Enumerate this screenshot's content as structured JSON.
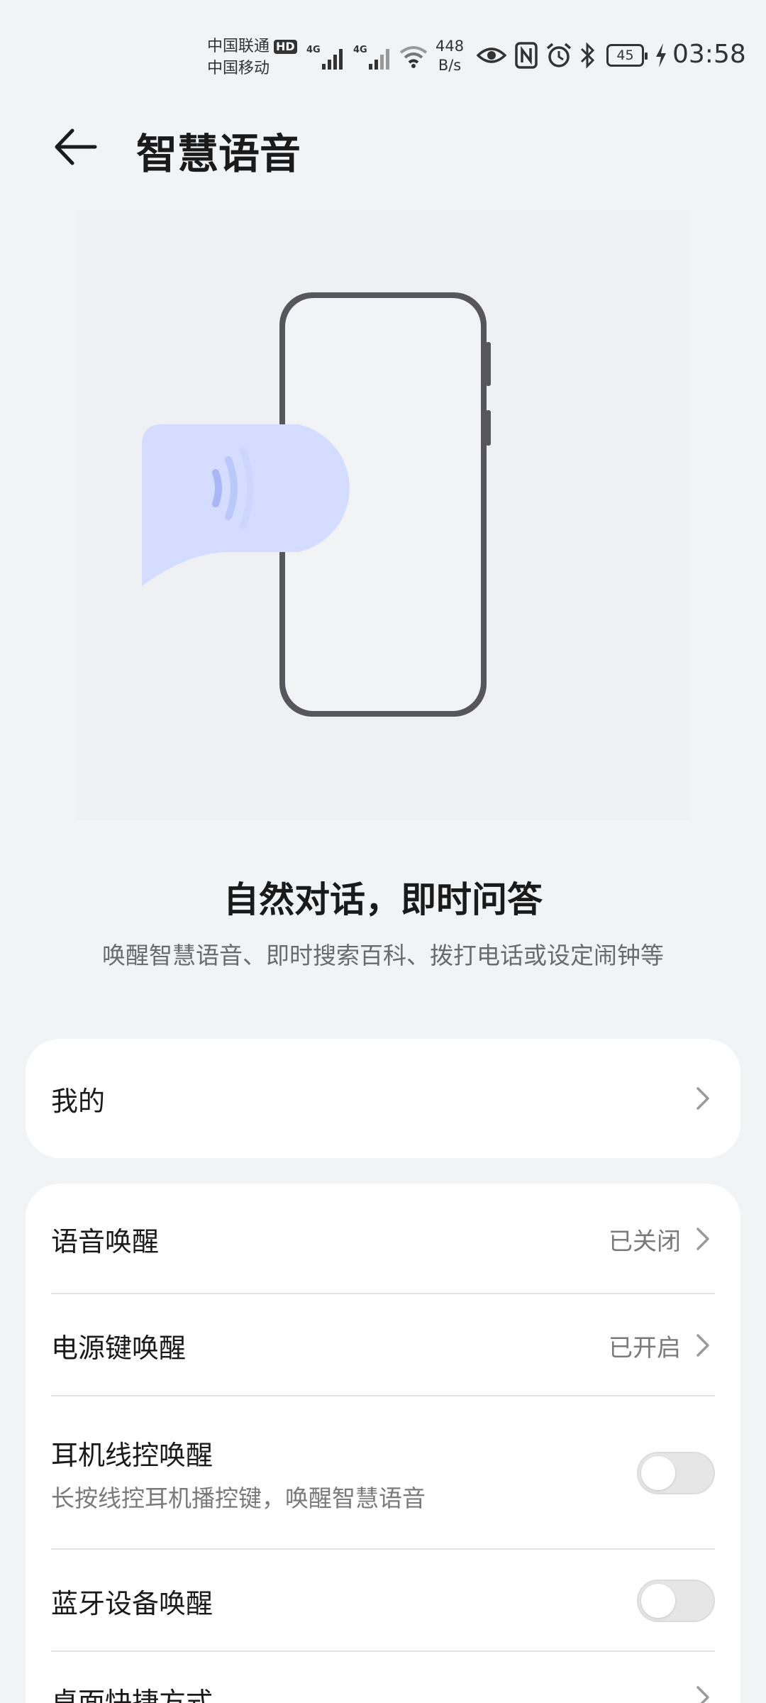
{
  "status_bar": {
    "carrier_1": "中国联通",
    "carrier_1_badge": "HD",
    "carrier_2": "中国移动",
    "sim1_network": "4G",
    "sim2_network": "4G",
    "net_speed_value": "448",
    "net_speed_unit": "B/s",
    "battery_level": "45",
    "time": "03:58",
    "icons": [
      "eye-comfort-icon",
      "nfc-icon",
      "alarm-icon",
      "bluetooth-icon",
      "charging-icon"
    ]
  },
  "header": {
    "title": "智慧语音",
    "back_icon": "back-arrow-icon"
  },
  "hero": {
    "title": "自然对话，即时问答",
    "subtitle": "唤醒智慧语音、即时搜索百科、拨打电话或设定闹钟等"
  },
  "card_mine": {
    "label": "我的"
  },
  "settings": [
    {
      "label": "语音唤醒",
      "status": "已关闭"
    },
    {
      "label": "电源键唤醒",
      "status": "已开启"
    },
    {
      "label": "耳机线控唤醒",
      "description": "长按线控耳机播控键，唤醒智慧语音",
      "toggle_on": false
    },
    {
      "label": "蓝牙设备唤醒",
      "toggle_on": false
    },
    {
      "label": "桌面快捷方式"
    }
  ],
  "colors": {
    "background": "#f1f3f5",
    "card": "#ffffff",
    "bubble": "#d4ddff",
    "phone_frame": "#56565c"
  }
}
